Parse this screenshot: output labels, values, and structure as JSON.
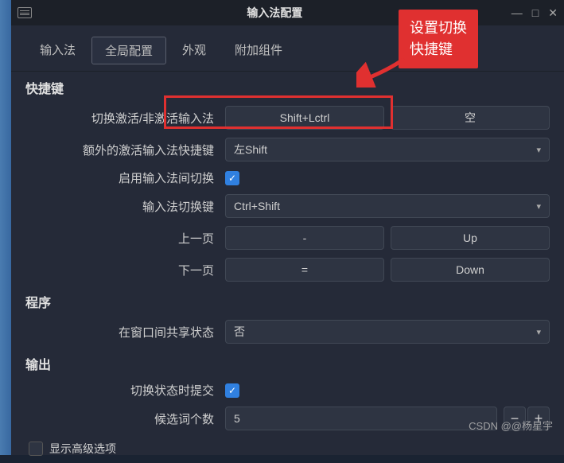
{
  "titlebar": {
    "title": "输入法配置"
  },
  "tabs": {
    "items": [
      {
        "label": "输入法"
      },
      {
        "label": "全局配置"
      },
      {
        "label": "外观"
      },
      {
        "label": "附加组件"
      }
    ]
  },
  "sections": {
    "hotkey": {
      "title": "快捷键",
      "toggle_activate": {
        "label": "切换激活/非激活输入法",
        "val1": "Shift+Lctrl",
        "val2": "空"
      },
      "extra_activate": {
        "label": "额外的激活输入法快捷键",
        "value": "左Shift"
      },
      "enable_switch": {
        "label": "启用输入法间切换"
      },
      "switch_key": {
        "label": "输入法切换键",
        "value": "Ctrl+Shift"
      },
      "prev_page": {
        "label": "上一页",
        "val1": "-",
        "val2": "Up"
      },
      "next_page": {
        "label": "下一页",
        "val1": "=",
        "val2": "Down"
      }
    },
    "program": {
      "title": "程序",
      "share_state": {
        "label": "在窗口间共享状态",
        "value": "否"
      }
    },
    "output": {
      "title": "输出",
      "commit_on_switch": {
        "label": "切换状态时提交"
      },
      "candidate_count": {
        "label": "候选词个数",
        "value": "5"
      },
      "show_advanced": {
        "label": "显示高级选项"
      }
    }
  },
  "annotation": {
    "callout_line1": "设置切换",
    "callout_line2": "快捷键"
  },
  "watermark": "CSDN @@杨星宇"
}
